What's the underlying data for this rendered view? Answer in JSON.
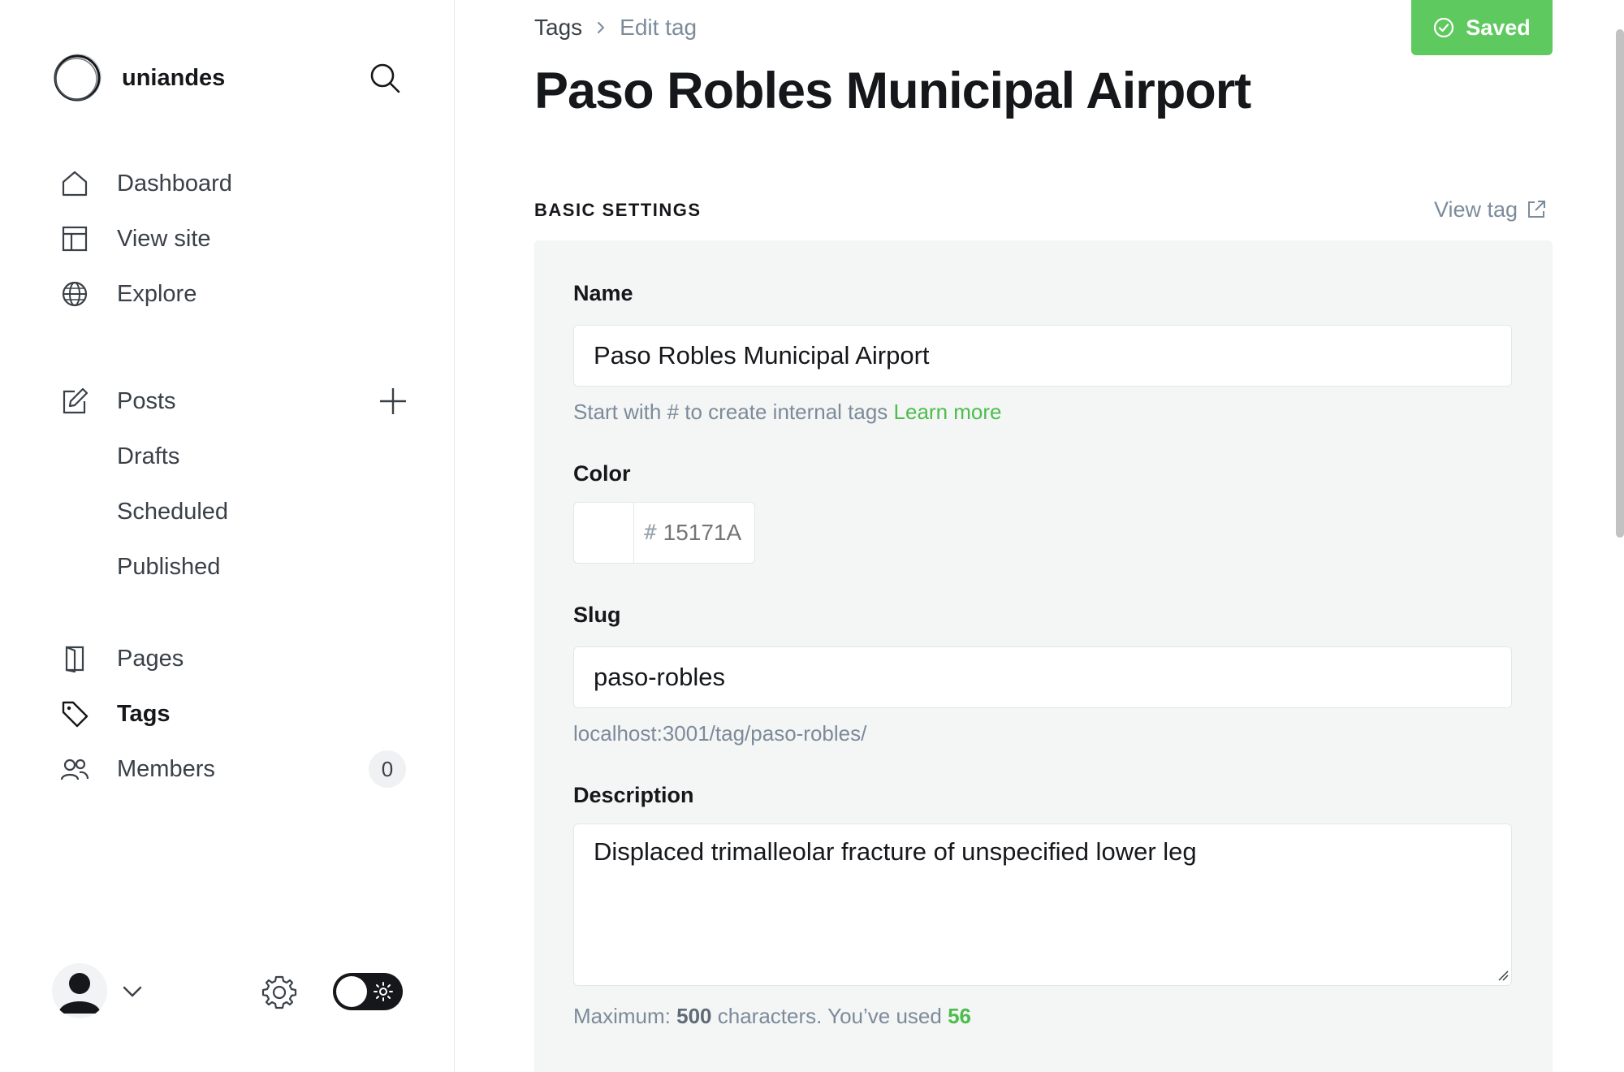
{
  "app": {
    "brand_name": "uniandes"
  },
  "sidebar": {
    "items": [
      {
        "label": "Dashboard",
        "icon": "home-icon"
      },
      {
        "label": "View site",
        "icon": "layout-icon"
      },
      {
        "label": "Explore",
        "icon": "globe-icon"
      },
      {
        "label": "Posts",
        "icon": "edit-icon"
      },
      {
        "label": "Pages",
        "icon": "pages-icon"
      },
      {
        "label": "Tags",
        "icon": "tag-icon",
        "active": true
      },
      {
        "label": "Members",
        "icon": "members-icon",
        "badge": "0"
      }
    ],
    "posts_subitems": [
      "Drafts",
      "Scheduled",
      "Published"
    ]
  },
  "header": {
    "breadcrumb": [
      "Tags",
      "Edit tag"
    ],
    "saved_label": "Saved",
    "title": "Paso Robles Municipal Airport"
  },
  "settings": {
    "section_label": "BASIC SETTINGS",
    "view_tag_label": "View tag",
    "name": {
      "label": "Name",
      "value": "Paso Robles Municipal Airport",
      "hint": "Start with # to create internal tags",
      "hint_link": "Learn more"
    },
    "color": {
      "label": "Color",
      "hash": "#",
      "placeholder": "15171A"
    },
    "slug": {
      "label": "Slug",
      "value": "paso-robles",
      "url": "localhost:3001/tag/paso-robles/"
    },
    "description": {
      "label": "Description",
      "value": "Displaced trimalleolar fracture of unspecified lower leg",
      "hint_prefix": "Maximum:",
      "max": "500",
      "hint_mid": "characters. You’ve used",
      "used": "56"
    }
  },
  "colors": {
    "accent_green": "#5ec95e",
    "link_green": "#4dbd4d",
    "text_dark": "#15171a",
    "muted": "#7c8b9a"
  }
}
